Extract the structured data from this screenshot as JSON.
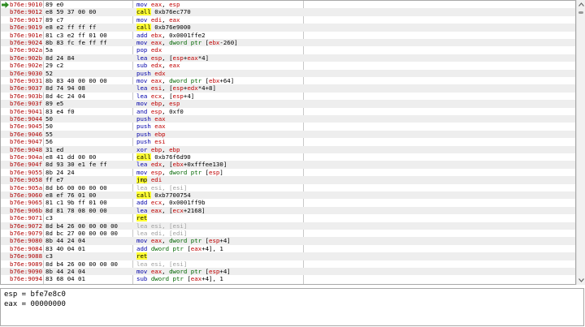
{
  "disassembly": {
    "current_index": 0,
    "rows": [
      {
        "addr": "b76e:9010",
        "bytes": "89 e0",
        "mn": "mov",
        "ops": [
          [
            "reg",
            "eax"
          ],
          [
            "imm",
            ", "
          ],
          [
            "reg",
            "esp"
          ]
        ]
      },
      {
        "addr": "b76e:9012",
        "bytes": "e8 59 37 00 00",
        "mn": "call",
        "ops": [
          [
            "imm",
            "0xb76ec770"
          ]
        ]
      },
      {
        "addr": "b76e:9017",
        "bytes": "89 c7",
        "mn": "mov",
        "ops": [
          [
            "reg",
            "edi"
          ],
          [
            "imm",
            ", "
          ],
          [
            "reg",
            "eax"
          ]
        ]
      },
      {
        "addr": "b76e:9019",
        "bytes": "e8 e2 ff ff ff",
        "mn": "call",
        "ops": [
          [
            "imm",
            "0xb76e9000"
          ]
        ]
      },
      {
        "addr": "b76e:901e",
        "bytes": "81 c3 e2 ff 01 00",
        "mn": "add",
        "ops": [
          [
            "reg",
            "ebx"
          ],
          [
            "imm",
            ", 0x0001ffe2"
          ]
        ]
      },
      {
        "addr": "b76e:9024",
        "bytes": "8b 83 fc fe ff ff",
        "mn": "mov",
        "ops": [
          [
            "reg",
            "eax"
          ],
          [
            "imm",
            ", "
          ],
          [
            "ptr",
            "dword ptr "
          ],
          [
            "imm",
            "["
          ],
          [
            "reg",
            "ebx"
          ],
          [
            "imm",
            "-260]"
          ]
        ]
      },
      {
        "addr": "b76e:902a",
        "bytes": "5a",
        "mn": "pop",
        "ops": [
          [
            "reg",
            "edx"
          ]
        ]
      },
      {
        "addr": "b76e:902b",
        "bytes": "8d 24 84",
        "mn": "lea",
        "ops": [
          [
            "reg",
            "esp"
          ],
          [
            "imm",
            ", ["
          ],
          [
            "reg",
            "esp"
          ],
          [
            "imm",
            "+"
          ],
          [
            "reg",
            "eax"
          ],
          [
            "imm",
            "*4]"
          ]
        ]
      },
      {
        "addr": "b76e:902e",
        "bytes": "29 c2",
        "mn": "sub",
        "ops": [
          [
            "reg",
            "edx"
          ],
          [
            "imm",
            ", "
          ],
          [
            "reg",
            "eax"
          ]
        ]
      },
      {
        "addr": "b76e:9030",
        "bytes": "52",
        "mn": "push",
        "ops": [
          [
            "reg",
            "edx"
          ]
        ]
      },
      {
        "addr": "b76e:9031",
        "bytes": "8b 83 40 00 00 00",
        "mn": "mov",
        "ops": [
          [
            "reg",
            "eax"
          ],
          [
            "imm",
            ", "
          ],
          [
            "ptr",
            "dword ptr "
          ],
          [
            "imm",
            "["
          ],
          [
            "reg",
            "ebx"
          ],
          [
            "imm",
            "+64]"
          ]
        ]
      },
      {
        "addr": "b76e:9037",
        "bytes": "8d 74 94 08",
        "mn": "lea",
        "ops": [
          [
            "reg",
            "esi"
          ],
          [
            "imm",
            ", ["
          ],
          [
            "reg",
            "esp"
          ],
          [
            "imm",
            "+"
          ],
          [
            "reg",
            "edx"
          ],
          [
            "imm",
            "*4+8]"
          ]
        ]
      },
      {
        "addr": "b76e:903b",
        "bytes": "8d 4c 24 04",
        "mn": "lea",
        "ops": [
          [
            "reg",
            "ecx"
          ],
          [
            "imm",
            ", ["
          ],
          [
            "reg",
            "esp"
          ],
          [
            "imm",
            "+4]"
          ]
        ]
      },
      {
        "addr": "b76e:903f",
        "bytes": "89 e5",
        "mn": "mov",
        "ops": [
          [
            "reg",
            "ebp"
          ],
          [
            "imm",
            ", "
          ],
          [
            "reg",
            "esp"
          ]
        ]
      },
      {
        "addr": "b76e:9041",
        "bytes": "83 e4 f0",
        "mn": "and",
        "ops": [
          [
            "reg",
            "esp"
          ],
          [
            "imm",
            ", 0xf0"
          ]
        ]
      },
      {
        "addr": "b76e:9044",
        "bytes": "50",
        "mn": "push",
        "ops": [
          [
            "reg",
            "eax"
          ]
        ]
      },
      {
        "addr": "b76e:9045",
        "bytes": "50",
        "mn": "push",
        "ops": [
          [
            "reg",
            "eax"
          ]
        ]
      },
      {
        "addr": "b76e:9046",
        "bytes": "55",
        "mn": "push",
        "ops": [
          [
            "reg",
            "ebp"
          ]
        ]
      },
      {
        "addr": "b76e:9047",
        "bytes": "56",
        "mn": "push",
        "ops": [
          [
            "reg",
            "esi"
          ]
        ]
      },
      {
        "addr": "b76e:9048",
        "bytes": "31 ed",
        "mn": "xor",
        "ops": [
          [
            "reg",
            "ebp"
          ],
          [
            "imm",
            ", "
          ],
          [
            "reg",
            "ebp"
          ]
        ]
      },
      {
        "addr": "b76e:904a",
        "bytes": "e8 41 dd 00 00",
        "mn": "call",
        "ops": [
          [
            "imm",
            "0xb76f6d90"
          ]
        ]
      },
      {
        "addr": "b76e:904f",
        "bytes": "8d 93 30 e1 fe ff",
        "mn": "lea",
        "ops": [
          [
            "reg",
            "edx"
          ],
          [
            "imm",
            ", ["
          ],
          [
            "reg",
            "ebx"
          ],
          [
            "imm",
            "+0xfffee130]"
          ]
        ]
      },
      {
        "addr": "b76e:9055",
        "bytes": "8b 24 24",
        "mn": "mov",
        "ops": [
          [
            "reg",
            "esp"
          ],
          [
            "imm",
            ", "
          ],
          [
            "ptr",
            "dword ptr "
          ],
          [
            "imm",
            "["
          ],
          [
            "reg",
            "esp"
          ],
          [
            "imm",
            "]"
          ]
        ]
      },
      {
        "addr": "b76e:9058",
        "bytes": "ff e7",
        "mn": "jmp",
        "ops": [
          [
            "reg",
            "edi"
          ]
        ]
      },
      {
        "addr": "b76e:905a",
        "bytes": "8d b6 00 00 00 00",
        "mn": "lea",
        "nop": true,
        "ops": [
          [
            "imm",
            "esi, [esi]"
          ]
        ]
      },
      {
        "addr": "b76e:9060",
        "bytes": "e8 ef 76 01 00",
        "mn": "call",
        "ops": [
          [
            "imm",
            "0xb7700754"
          ]
        ]
      },
      {
        "addr": "b76e:9065",
        "bytes": "81 c1 9b ff 01 00",
        "mn": "add",
        "ops": [
          [
            "reg",
            "ecx"
          ],
          [
            "imm",
            ", 0x0001ff9b"
          ]
        ]
      },
      {
        "addr": "b76e:906b",
        "bytes": "8d 81 78 08 00 00",
        "mn": "lea",
        "ops": [
          [
            "reg",
            "eax"
          ],
          [
            "imm",
            ", ["
          ],
          [
            "reg",
            "ecx"
          ],
          [
            "imm",
            "+2168]"
          ]
        ]
      },
      {
        "addr": "b76e:9071",
        "bytes": "c3",
        "mn": "ret",
        "ops": []
      },
      {
        "addr": "b76e:9072",
        "bytes": "8d b4 26 00 00 00 00",
        "mn": "lea",
        "nop": true,
        "ops": [
          [
            "imm",
            "esi, [esi]"
          ]
        ]
      },
      {
        "addr": "b76e:9079",
        "bytes": "8d bc 27 00 00 00 00",
        "mn": "lea",
        "nop": true,
        "ops": [
          [
            "imm",
            "edi, [edi]"
          ]
        ]
      },
      {
        "addr": "b76e:9080",
        "bytes": "8b 44 24 04",
        "mn": "mov",
        "ops": [
          [
            "reg",
            "eax"
          ],
          [
            "imm",
            ", "
          ],
          [
            "ptr",
            "dword ptr "
          ],
          [
            "imm",
            "["
          ],
          [
            "reg",
            "esp"
          ],
          [
            "imm",
            "+4]"
          ]
        ]
      },
      {
        "addr": "b76e:9084",
        "bytes": "83 40 04 01",
        "mn": "add",
        "ops": [
          [
            "ptr",
            "dword ptr "
          ],
          [
            "imm",
            "["
          ],
          [
            "reg",
            "eax"
          ],
          [
            "imm",
            "+4], 1"
          ]
        ]
      },
      {
        "addr": "b76e:9088",
        "bytes": "c3",
        "mn": "ret",
        "ops": []
      },
      {
        "addr": "b76e:9089",
        "bytes": "8d b4 26 00 00 00 00",
        "mn": "lea",
        "nop": true,
        "ops": [
          [
            "imm",
            "esi, [esi]"
          ]
        ]
      },
      {
        "addr": "b76e:9090",
        "bytes": "8b 44 24 04",
        "mn": "mov",
        "ops": [
          [
            "reg",
            "eax"
          ],
          [
            "imm",
            ", "
          ],
          [
            "ptr",
            "dword ptr "
          ],
          [
            "imm",
            "["
          ],
          [
            "reg",
            "esp"
          ],
          [
            "imm",
            "+4]"
          ]
        ]
      },
      {
        "addr": "b76e:9094",
        "bytes": "83 68 04 01",
        "mn": "sub",
        "ops": [
          [
            "ptr",
            "dword ptr "
          ],
          [
            "imm",
            "["
          ],
          [
            "reg",
            "eax"
          ],
          [
            "imm",
            "+4], 1"
          ]
        ]
      }
    ]
  },
  "registers": {
    "lines": [
      "esp = bfe7e8c0",
      "eax = 00000000"
    ]
  },
  "colors": {
    "address": "#b00000",
    "register": "#c00000",
    "mnemonic": "#0000aa",
    "pointer": "#006600",
    "branch_highlight": "#ffff33",
    "current_arrow": "#2e8b22"
  }
}
